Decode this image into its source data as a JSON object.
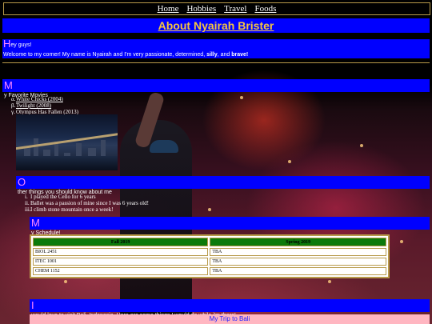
{
  "nav": {
    "items": [
      "Home",
      "Hobbies",
      "Travel",
      "Foods"
    ]
  },
  "page_title": "About Nyairah Brister",
  "intro": {
    "heading_first": "H",
    "heading_rest": "ey guys!",
    "text_before": "Welcome to my corner! My name is Nyairah and I'm very passionate, determined, ",
    "bold_silly": "silly",
    "text_mid": ", and ",
    "bold_brave": "brave!"
  },
  "movies": {
    "heading_first": "M",
    "heading_rest": "y Favorite Movies",
    "items": [
      {
        "marker": "α.",
        "title": "White Chicks (2004)"
      },
      {
        "marker": "β.",
        "title": "Twilight (2008)"
      },
      {
        "marker": "γ.",
        "title": "Olympus Has Fallen (2013)"
      }
    ]
  },
  "other": {
    "heading_first": "O",
    "heading_rest": "ther things you should know about me",
    "items": [
      {
        "marker": "i.",
        "text": "I played the Cello for 6 years"
      },
      {
        "marker": "ii.",
        "text": "Ballet was a passion of mine since I was 6 years old!"
      },
      {
        "marker": "iii.",
        "text": "I climb stone mountain once a week!"
      }
    ]
  },
  "schedule": {
    "heading_first": "M",
    "heading_rest": "y Schedule!",
    "columns": [
      "Fall 2019",
      "Spring 2019"
    ],
    "rows": [
      [
        "BIOL 2451",
        "TBA"
      ],
      [
        "ITEC 1001",
        "TBA"
      ],
      [
        "CHEM 1152",
        "TBA"
      ]
    ]
  },
  "bali": {
    "heading_first": "I",
    "heading_rest": " would love to visit Bali, Indonesia. Here are some things I would do while i'm there!",
    "trip_label": "My Trip to Bali"
  },
  "colors": {
    "section_bar": "#0000ff",
    "heading_initial": "#ff88ff",
    "title_text": "#f5c542",
    "table_header": "#0b7a0b",
    "trip_bar": "#ffb6c1"
  }
}
